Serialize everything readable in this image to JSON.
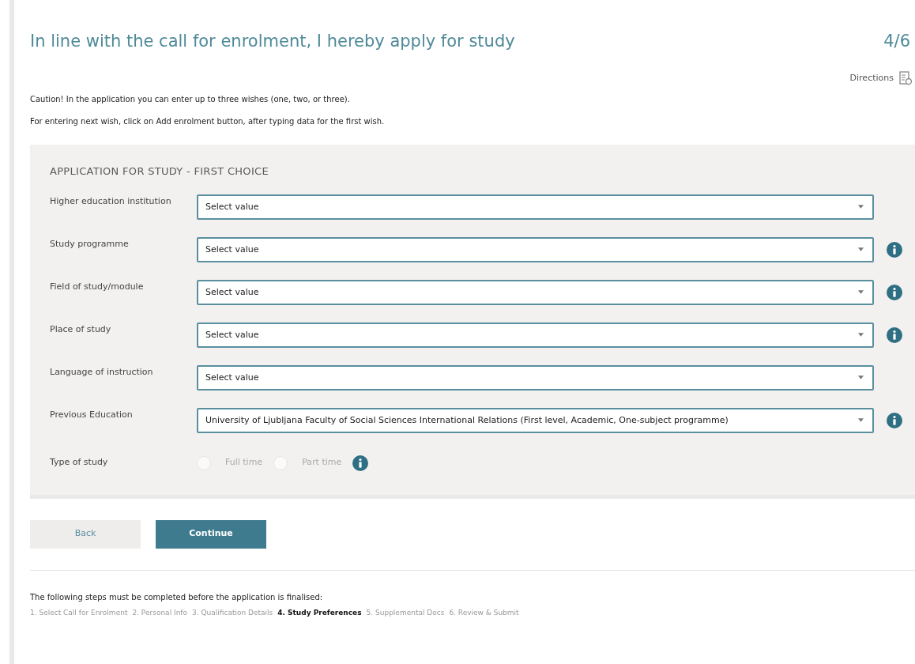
{
  "title": "In line with the call for enrolment, I hereby apply for study",
  "step_counter": "4/6",
  "directions": "Directions",
  "notes": [
    "Caution! In the application you can enter up to three wishes (one, two, or three).",
    "For entering next wish, click on Add enrolment button, after typing data for the first wish."
  ],
  "panel": {
    "heading": "APPLICATION FOR STUDY - FIRST CHOICE",
    "fields": [
      {
        "label": "Higher education institution",
        "value": "Select value",
        "info": false
      },
      {
        "label": "Study programme",
        "value": "Select value",
        "info": true
      },
      {
        "label": "Field of study/module",
        "value": "Select value",
        "info": true
      },
      {
        "label": "Place of study",
        "value": "Select value",
        "info": true
      },
      {
        "label": "Language of instruction",
        "value": "Select value",
        "info": false
      },
      {
        "label": "Previous Education",
        "value": "University of Ljubljana Faculty of Social Sciences International Relations (First level, Academic, One-subject programme)",
        "info": true
      }
    ],
    "type_of_study": {
      "label": "Type of study",
      "options": [
        {
          "label": "Full time",
          "checked": false
        },
        {
          "label": "Part time",
          "checked": false
        }
      ],
      "disabled": true
    }
  },
  "buttons": [
    "Back",
    "Continue"
  ],
  "steps_note": "The following steps must be completed before the application is finalised:",
  "steps": [
    {
      "label": "1. Select Call for Enrolment",
      "selected": false
    },
    {
      "label": "2. Personal Info",
      "selected": false
    },
    {
      "label": "3. Qualification Details",
      "selected": false
    },
    {
      "label": "4. Study Preferences",
      "selected": true
    },
    {
      "label": "5. Supplemental Docs",
      "selected": false
    },
    {
      "label": "6. Review & Submit",
      "selected": false
    }
  ]
}
